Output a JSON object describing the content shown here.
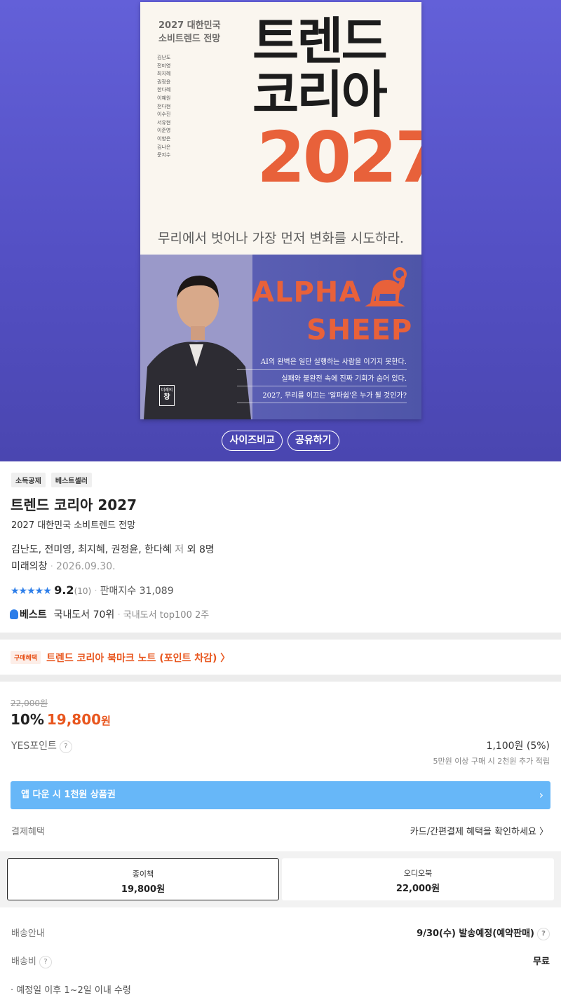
{
  "cover": {
    "subtitle_line1": "2027 대한민국",
    "subtitle_line2": "소비트렌드 전망",
    "authors": [
      "김난도",
      "전미영",
      "최지혜",
      "권정윤",
      "한다혜",
      "이혜원",
      "전다현",
      "이수진",
      "서유현",
      "이준영",
      "이향은",
      "김나은",
      "문지수"
    ],
    "title_line1": "트렌드",
    "title_line2": "코리아",
    "year": "2027",
    "slogan": "무리에서 벗어나 가장 먼저 변화를 시도하라.",
    "alpha": "ALPHA",
    "sheep": "SHEEP",
    "lines": [
      "AI의 완벽은 일단 실행하는 사람을 이기지 못한다.",
      "실패와 불완전 속에 진짜 기회가 숨어 있다.",
      "2027, 무리를 이끄는 '알파쉽'은 누가 될 것인가?"
    ],
    "publisher_logo_line1": "미래의",
    "publisher_logo_line2": "창"
  },
  "hero_buttons": {
    "size_compare": "사이즈비교",
    "share": "공유하기"
  },
  "tags": [
    "소득공제",
    "베스트셀러"
  ],
  "product": {
    "title": "트렌드 코리아 2027",
    "subtitle": "2027 대한민국 소비트렌드 전망",
    "authors": "김난도, 전미영, 최지혜, 권정윤, 한다혜",
    "author_role": "저",
    "author_extra": "외 8명",
    "publisher": "미래의창",
    "date": "2026.09.30.",
    "stars": "★★★★★",
    "score": "9.2",
    "review_count": "(10)",
    "sales_label": "판매지수 31,089",
    "best_label": "베스트",
    "best_rank": "국내도서 70위",
    "best_weeks": "국내도서 top100 2주"
  },
  "benefit": {
    "label": "구매혜택",
    "text": "트렌드 코리아 북마크 노트 (포인트 차감) 〉"
  },
  "price": {
    "original": "22,000원",
    "discount": "10%",
    "sale": "19,800",
    "won": "원",
    "point_label": "YES포인트",
    "point_value": "1,100원 (5%)",
    "point_note": "5만원 이상 구매 시 2천원 추가 적립"
  },
  "app_banner": {
    "text": "앱 다운 시 1천원 상품권",
    "chevron": "›"
  },
  "payment": {
    "label": "결제혜택",
    "value": "카드/간편결제 혜택을 확인하세요 〉"
  },
  "formats": [
    {
      "name": "종이책",
      "price": "19,800원"
    },
    {
      "name": "오디오북",
      "price": "22,000원"
    }
  ],
  "shipping": {
    "label": "배송안내",
    "value": "9/30(수) 발송예정(예약판매)",
    "fee_label": "배송비",
    "fee_value": "무료",
    "note": "· 예정일 이후 1~2일 이내 수령"
  },
  "help_icon": "?",
  "colors": {
    "hero": "#5a56cc",
    "accent": "#e8561e",
    "app_banner": "#67b7f8",
    "star": "#2b7de9"
  }
}
